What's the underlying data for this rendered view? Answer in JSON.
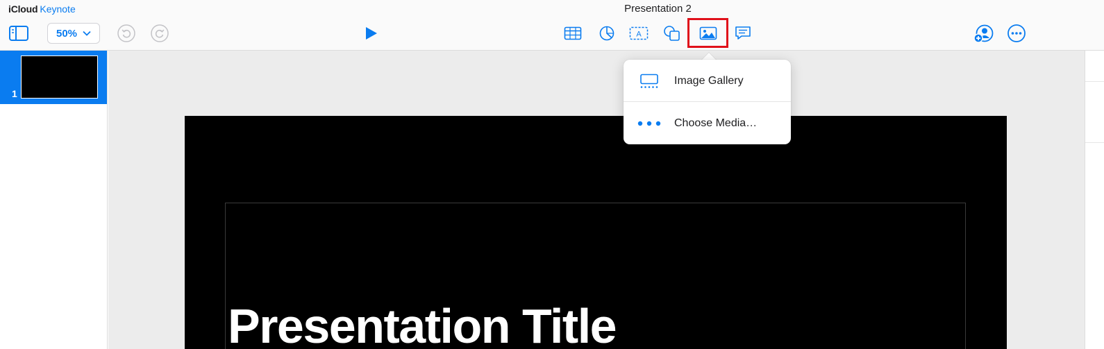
{
  "brand": {
    "icloud": "iCloud",
    "app": "Keynote"
  },
  "document": {
    "title": "Presentation 2"
  },
  "toolbar": {
    "zoom_value": "50%",
    "icons": [
      "sidebar-icon",
      "undo-icon",
      "redo-icon",
      "play-icon",
      "table-icon",
      "chart-icon",
      "text-box-icon",
      "shape-icon",
      "media-icon",
      "comment-icon",
      "collaborate-icon",
      "more-icon"
    ]
  },
  "navigator": {
    "slides": [
      {
        "number": "1",
        "selected": true
      }
    ]
  },
  "slide": {
    "title": "Presentation Title"
  },
  "media_menu": {
    "items": [
      {
        "label": "Image Gallery",
        "icon": "image-gallery-icon"
      },
      {
        "label": "Choose Media…",
        "icon": "more-dots-icon"
      }
    ]
  },
  "colors": {
    "accent": "#0A7CF0",
    "highlight_box": "#E0101A",
    "slide_background": "#000000",
    "canvas_background": "#ECECEC"
  }
}
